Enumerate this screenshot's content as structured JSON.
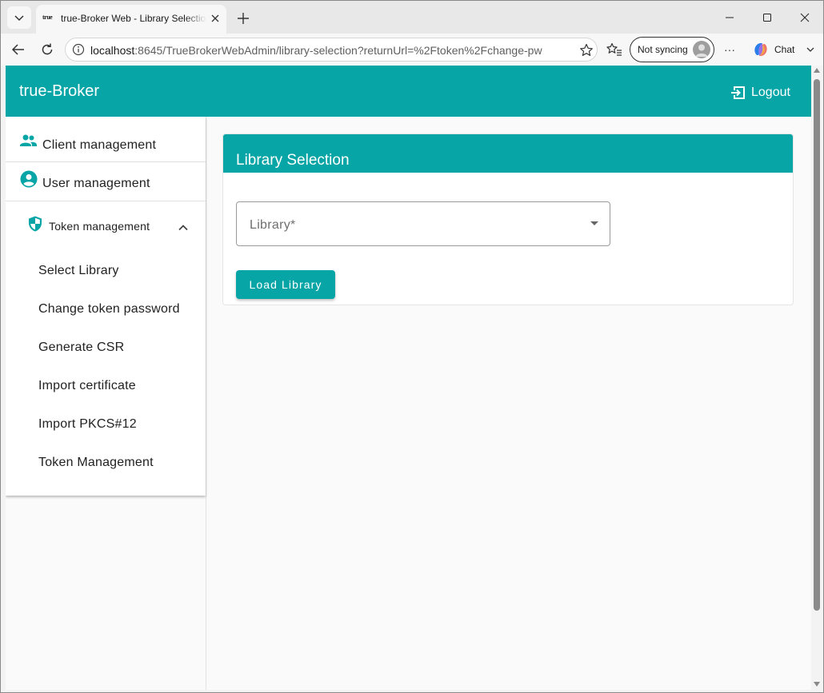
{
  "browser": {
    "tab_title": "true-Broker Web - Library Selection",
    "tab_favicon_text": "true",
    "url_host": "localhost",
    "url_rest": ":8645/TrueBrokerWebAdmin/library-selection?returnUrl=%2Ftoken%2Fchange-pw",
    "profile_status": "Not syncing",
    "more_label": "···",
    "chat_label": "Chat"
  },
  "app": {
    "brand": "true-Broker",
    "logout_label": "Logout",
    "accent_color": "#08a5a7"
  },
  "sidebar": {
    "items": [
      {
        "label": "Client management",
        "icon": "people-icon"
      },
      {
        "label": "User management",
        "icon": "account-circle-icon"
      }
    ],
    "group": {
      "label": "Token management",
      "icon": "shield-icon",
      "expanded": true,
      "children": [
        {
          "label": "Select Library"
        },
        {
          "label": "Change token password"
        },
        {
          "label": "Generate CSR"
        },
        {
          "label": "Import certificate"
        },
        {
          "label": "Import PKCS#12"
        },
        {
          "label": "Token Management"
        }
      ]
    }
  },
  "main": {
    "card_title": "Library Selection",
    "library_field": {
      "label": "Library*",
      "value": ""
    },
    "load_button": "Load Library"
  }
}
